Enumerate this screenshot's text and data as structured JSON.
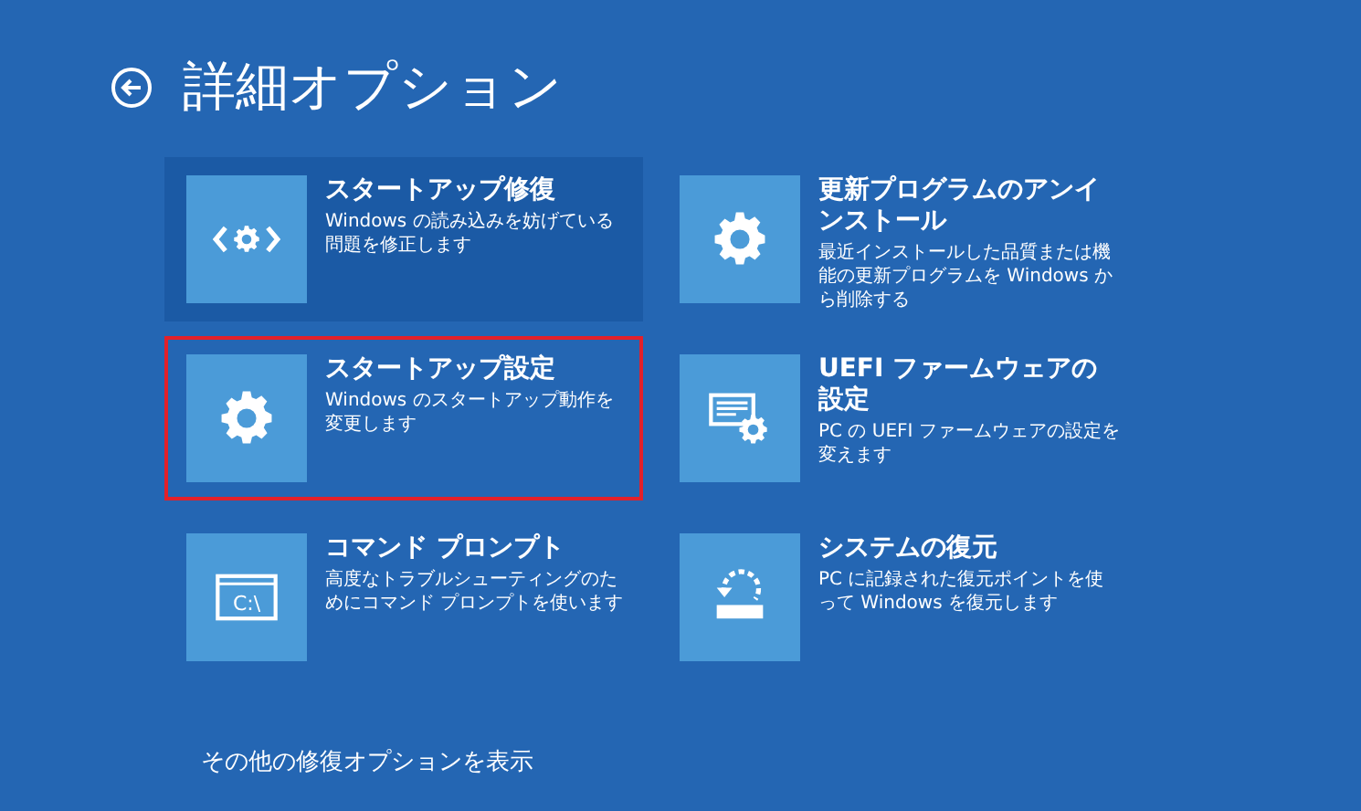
{
  "title": "詳細オプション",
  "options": [
    {
      "kind": "repair",
      "title": "スタートアップ修復",
      "description": "Windows の読み込みを妨げている問題を修正します",
      "focused": true,
      "highlighted": false
    },
    {
      "kind": "gear",
      "title": "更新プログラムのアンインストール",
      "description": "最近インストールした品質または機能の更新プログラムを Windows から削除する",
      "focused": false,
      "highlighted": false
    },
    {
      "kind": "gear",
      "title": "スタートアップ設定",
      "description": "Windows のスタートアップ動作を変更します",
      "focused": false,
      "highlighted": true
    },
    {
      "kind": "firmware",
      "title": "UEFI ファームウェアの設定",
      "description": "PC の UEFI ファームウェアの設定を変えます",
      "focused": false,
      "highlighted": false
    },
    {
      "kind": "console",
      "icon_text": "C:\\",
      "title": "コマンド プロンプト",
      "description": "高度なトラブルシューティングのためにコマンド プロンプトを使います",
      "focused": false,
      "highlighted": false
    },
    {
      "kind": "restore",
      "title": "システムの復元",
      "description": "PC に記録された復元ポイントを使って Windows を復元します",
      "focused": false,
      "highlighted": false
    }
  ],
  "more_link": "その他の修復オプションを表示"
}
